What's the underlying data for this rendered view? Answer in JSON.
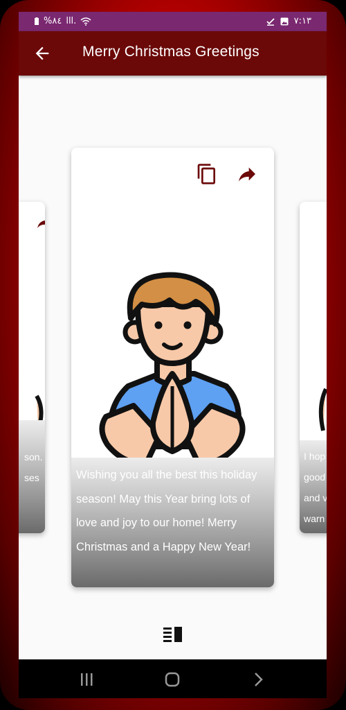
{
  "status_bar": {
    "battery": "%٨٤",
    "signal": "lll.",
    "time": "٧:١٣"
  },
  "app_bar": {
    "title": "Merry Christmas Greetings",
    "back_icon": "arrow-back-icon"
  },
  "cards": {
    "main": {
      "message": "Wishing you all the best this holiday season! May this Year bring lots of love and joy to our home! Merry Christmas and a Happy New Year!",
      "copy_icon": "copy-icon",
      "share_icon": "share-icon",
      "illustration": "praying-man-illustration"
    },
    "left": {
      "line1": "son.",
      "line2": "ses"
    },
    "right": {
      "line1": "I hop",
      "line2": "good",
      "line3": "and v",
      "line4": "warn"
    }
  },
  "bottom": {
    "toggle_icon": "view-toggle-icon"
  },
  "nav": {
    "recents_icon": "recents-icon",
    "home_icon": "home-icon",
    "back_icon": "nav-back-icon"
  },
  "colors": {
    "app_bar": "#6b0808",
    "status_bar": "#7a2870",
    "accent": "#6b0808"
  }
}
